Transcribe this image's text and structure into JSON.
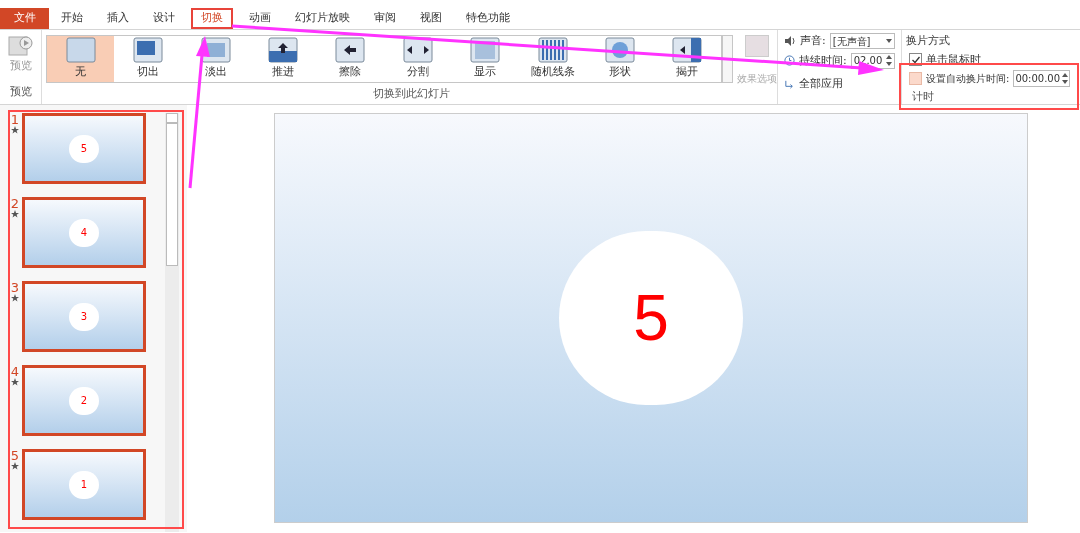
{
  "ribbon_tabs": [
    {
      "label": "文件",
      "kind": "file",
      "selected": false
    },
    {
      "label": "开始",
      "kind": "tab",
      "selected": false
    },
    {
      "label": "插入",
      "kind": "tab",
      "selected": false
    },
    {
      "label": "设计",
      "kind": "tab",
      "selected": false
    },
    {
      "label": "切换",
      "kind": "tab",
      "selected": true
    },
    {
      "label": "动画",
      "kind": "tab",
      "selected": false
    },
    {
      "label": "幻灯片放映",
      "kind": "tab",
      "selected": false
    },
    {
      "label": "审阅",
      "kind": "tab",
      "selected": false
    },
    {
      "label": "视图",
      "kind": "tab",
      "selected": false
    },
    {
      "label": "特色功能",
      "kind": "tab",
      "selected": false
    }
  ],
  "ribbon": {
    "preview": {
      "button": "预览",
      "group_label": "预览"
    },
    "transitions": {
      "items": [
        {
          "label": "无",
          "selected": true
        },
        {
          "label": "切出",
          "selected": false
        },
        {
          "label": "淡出",
          "selected": false
        },
        {
          "label": "推进",
          "selected": false
        },
        {
          "label": "擦除",
          "selected": false
        },
        {
          "label": "分割",
          "selected": false
        },
        {
          "label": "显示",
          "selected": false
        },
        {
          "label": "随机线条",
          "selected": false
        },
        {
          "label": "形状",
          "selected": false
        },
        {
          "label": "揭开",
          "selected": false
        }
      ],
      "effect_options": {
        "label": "效果选项",
        "disabled": true
      },
      "group_label": "切换到此幻灯片"
    },
    "timing": {
      "sound_label": "声音:",
      "sound_value": "[无声音]",
      "duration_label": "持续时间:",
      "duration_value": "02.00",
      "apply_all": "全部应用",
      "advance_heading": "换片方式",
      "on_click": {
        "label": "单击鼠标时",
        "checked": true
      },
      "auto_advance": {
        "label": "设置自动换片时间:",
        "checked": false,
        "value": "00:00.00"
      },
      "group_label": "计时"
    }
  },
  "thumbnails": [
    {
      "number": "1",
      "slide_text": "5",
      "selected": true
    },
    {
      "number": "2",
      "slide_text": "4",
      "selected": true
    },
    {
      "number": "3",
      "slide_text": "3",
      "selected": true
    },
    {
      "number": "4",
      "slide_text": "2",
      "selected": true
    },
    {
      "number": "5",
      "slide_text": "1",
      "selected": true
    }
  ],
  "slide": {
    "text": "5"
  }
}
